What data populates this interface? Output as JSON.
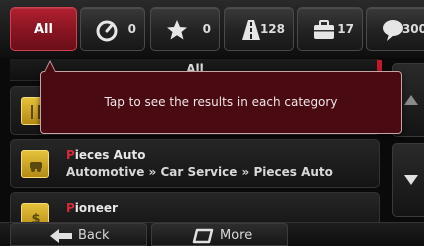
{
  "tabs": {
    "all_label": "All",
    "speed_count": "0",
    "favorites_count": "0",
    "road_count": "128",
    "work_count": "17",
    "chat_count": "300"
  },
  "category_header": "All",
  "tooltip_text": "Tap to see the results in each category",
  "results": [
    {
      "name_prefix": "P",
      "name_rest": "ieces Auto",
      "path": "Automotive » Car Service » Pieces Auto"
    },
    {
      "name_prefix": "P",
      "name_rest": "ioneer",
      "path": ""
    }
  ],
  "bottom_bar": {
    "back_label": "Back",
    "more_label": "More"
  },
  "colors": {
    "accent_red": "#c21a2c",
    "highlight": "#d42a3a",
    "category_icon_yellow": "#d8b22a",
    "tooltip_bg": "#4a0a12"
  }
}
